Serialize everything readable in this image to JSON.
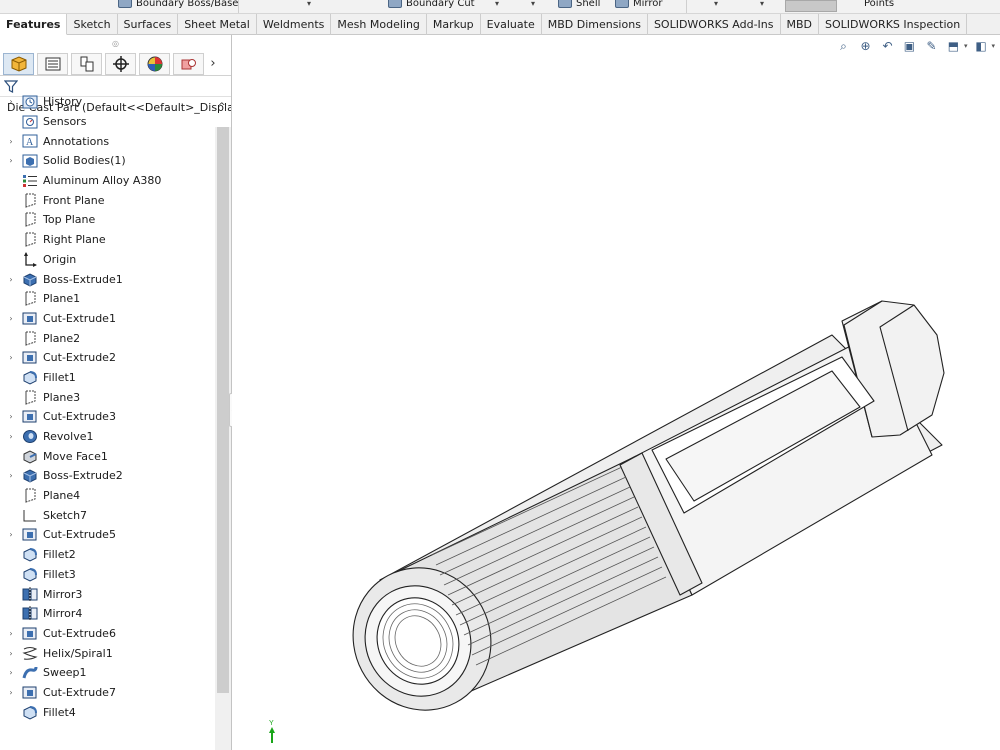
{
  "ribbon": {
    "boundary_boss": "Boundary Boss/Base",
    "boundary_cut": "Boundary Cut",
    "shell": "Shell",
    "mirror": "Mirror",
    "points": "Points"
  },
  "tabs": [
    {
      "label": "Features"
    },
    {
      "label": "Sketch"
    },
    {
      "label": "Surfaces"
    },
    {
      "label": "Sheet Metal"
    },
    {
      "label": "Weldments"
    },
    {
      "label": "Mesh Modeling"
    },
    {
      "label": "Markup"
    },
    {
      "label": "Evaluate"
    },
    {
      "label": "MBD Dimensions"
    },
    {
      "label": "SOLIDWORKS Add-Ins"
    },
    {
      "label": "MBD"
    },
    {
      "label": "SOLIDWORKS Inspection"
    }
  ],
  "tree": {
    "root_label": "Die Cast Part  (Default<<Default>_Displa",
    "items": [
      {
        "label": "History",
        "icon": "history-icon",
        "expandable": true
      },
      {
        "label": "Sensors",
        "icon": "sensors-icon",
        "expandable": false
      },
      {
        "label": "Annotations",
        "icon": "annotations-icon",
        "expandable": true
      },
      {
        "label": "Solid Bodies(1)",
        "icon": "solid-bodies-icon",
        "expandable": true
      },
      {
        "label": "Aluminum Alloy A380",
        "icon": "material-icon",
        "expandable": false
      },
      {
        "label": "Front Plane",
        "icon": "plane-icon",
        "expandable": false
      },
      {
        "label": "Top Plane",
        "icon": "plane-icon",
        "expandable": false
      },
      {
        "label": "Right Plane",
        "icon": "plane-icon",
        "expandable": false
      },
      {
        "label": "Origin",
        "icon": "origin-icon",
        "expandable": false
      },
      {
        "label": "Boss-Extrude1",
        "icon": "boss-extrude-icon",
        "expandable": true
      },
      {
        "label": "Plane1",
        "icon": "plane-icon",
        "expandable": false
      },
      {
        "label": "Cut-Extrude1",
        "icon": "cut-extrude-icon",
        "expandable": true
      },
      {
        "label": "Plane2",
        "icon": "plane-icon",
        "expandable": false
      },
      {
        "label": "Cut-Extrude2",
        "icon": "cut-extrude-icon",
        "expandable": true
      },
      {
        "label": "Fillet1",
        "icon": "fillet-icon",
        "expandable": false
      },
      {
        "label": "Plane3",
        "icon": "plane-icon",
        "expandable": false
      },
      {
        "label": "Cut-Extrude3",
        "icon": "cut-extrude-icon",
        "expandable": true
      },
      {
        "label": "Revolve1",
        "icon": "revolve-icon",
        "expandable": true
      },
      {
        "label": "Move Face1",
        "icon": "move-face-icon",
        "expandable": false
      },
      {
        "label": "Boss-Extrude2",
        "icon": "boss-extrude-icon",
        "expandable": true
      },
      {
        "label": "Plane4",
        "icon": "plane-icon",
        "expandable": false
      },
      {
        "label": "Sketch7",
        "icon": "sketch-icon",
        "expandable": false
      },
      {
        "label": "Cut-Extrude5",
        "icon": "cut-extrude-icon",
        "expandable": true
      },
      {
        "label": "Fillet2",
        "icon": "fillet-icon",
        "expandable": false
      },
      {
        "label": "Fillet3",
        "icon": "fillet-icon",
        "expandable": false
      },
      {
        "label": "Mirror3",
        "icon": "mirror-icon",
        "expandable": false
      },
      {
        "label": "Mirror4",
        "icon": "mirror-icon",
        "expandable": false
      },
      {
        "label": "Cut-Extrude6",
        "icon": "cut-extrude-icon",
        "expandable": true
      },
      {
        "label": "Helix/Spiral1",
        "icon": "helix-icon",
        "expandable": true
      },
      {
        "label": "Sweep1",
        "icon": "sweep-icon",
        "expandable": true
      },
      {
        "label": "Cut-Extrude7",
        "icon": "cut-extrude-icon",
        "expandable": true
      },
      {
        "label": "Fillet4",
        "icon": "fillet-icon",
        "expandable": false
      }
    ]
  },
  "triad": {
    "axis_label": "Y"
  },
  "colors": {
    "accent": "#2b579a",
    "tab_active": "#ffffff",
    "tree_icon_blue": "#3c6fb0"
  }
}
